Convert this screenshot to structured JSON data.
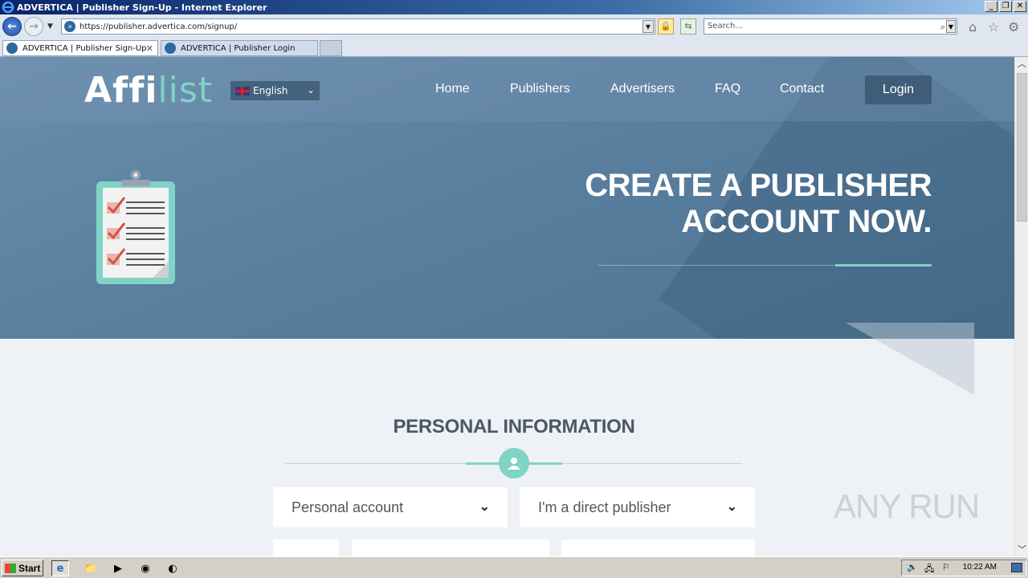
{
  "window": {
    "title": "ADVERTICA | Publisher Sign-Up - Internet Explorer"
  },
  "addressbar": {
    "url": "https://publisher.advertica.com/signup/",
    "search_placeholder": "Search..."
  },
  "tabs": [
    {
      "label": "ADVERTICA | Publisher Sign-Up",
      "active": true
    },
    {
      "label": "ADVERTICA | Publisher Login",
      "active": false
    }
  ],
  "site": {
    "logo_main": "Affi",
    "logo_accent": "list",
    "language": "English",
    "nav": [
      "Home",
      "Publishers",
      "Advertisers",
      "FAQ",
      "Contact"
    ],
    "login_label": "Login",
    "hero_title_line1": "CREATE A PUBLISHER",
    "hero_title_line2": "ACCOUNT NOW.",
    "section_title": "PERSONAL INFORMATION",
    "account_type": "Personal account",
    "publisher_type": "I'm a direct publisher",
    "accent_color": "#7fd4c6"
  },
  "watermark": "ANY RUN",
  "taskbar": {
    "start_label": "Start",
    "clock": "10:22 AM"
  }
}
